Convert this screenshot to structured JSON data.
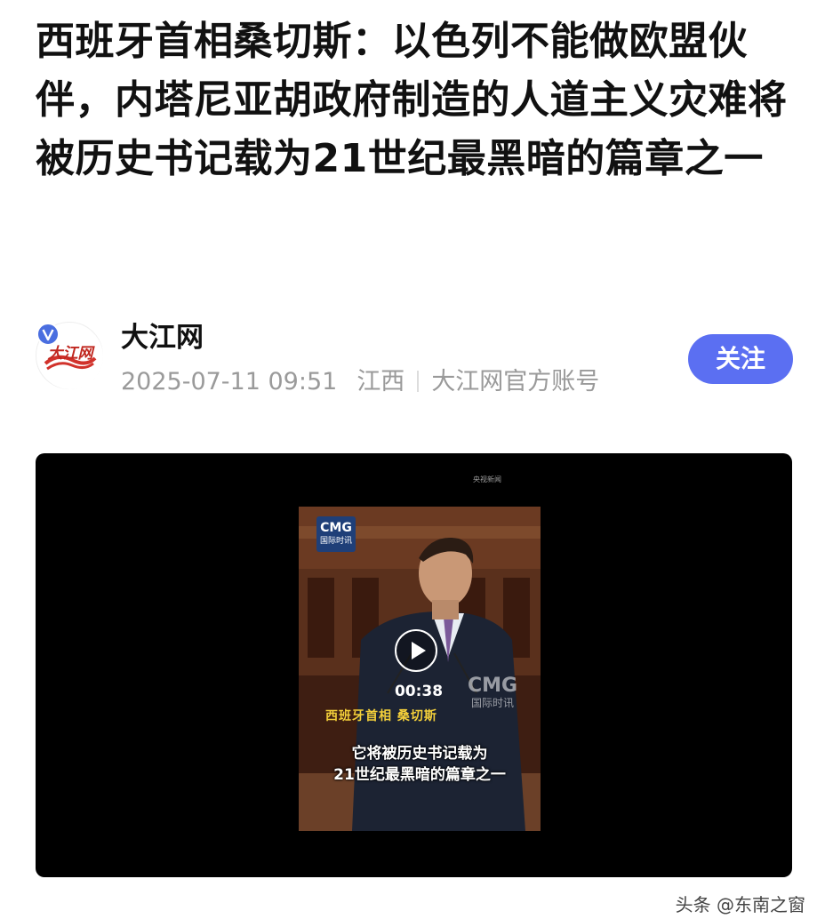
{
  "article": {
    "headline": "西班牙首相桑切斯：以色列不能做欧盟伙伴，内塔尼亚胡政府制造的人道主义灾难将被历史书记载为21世纪最黑暗的篇章之一"
  },
  "author": {
    "name": "大江网",
    "avatar_text": "大江网",
    "published": "2025-07-11 09:51",
    "region": "江西",
    "account_type": "大江网官方账号",
    "follow_label": "关注"
  },
  "video": {
    "logo_top": "CMG",
    "logo_bottom": "国际时讯",
    "watermark_top": "CMG",
    "watermark_bottom": "国际时讯",
    "duration": "00:38",
    "speaker_tag": "西班牙首相 桑切斯",
    "subtitle_line1": "它将被历史书记载为",
    "subtitle_line2": "21世纪最黑暗的篇章之一",
    "corner_source": "央视新闻"
  },
  "footer": {
    "source_watermark": "头条 @东南之窗"
  },
  "colors": {
    "follow_button": "#5b6ff2",
    "verified_badge": "#4a6ee0",
    "subtitle_tag": "#f3cf3a"
  }
}
